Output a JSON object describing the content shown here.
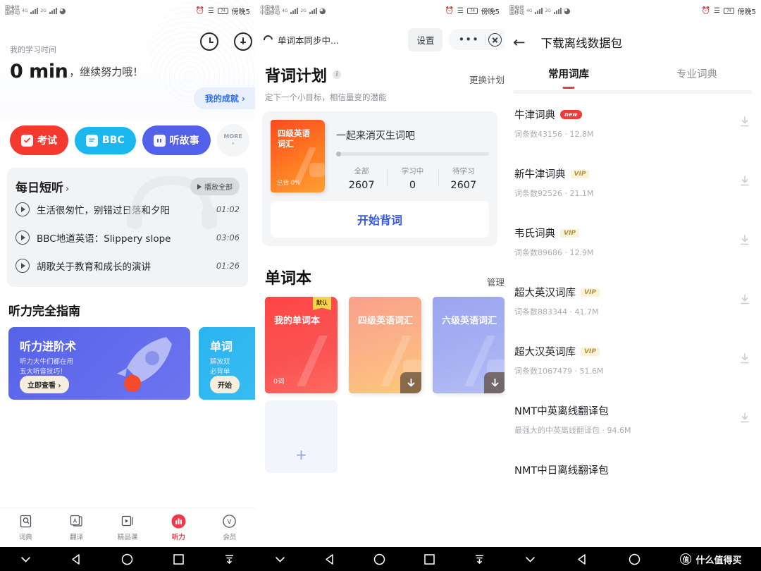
{
  "statusbar": {
    "carrier_line1": "国电信",
    "carrier_line2": "国移动",
    "carrier2_line1": "中国电信",
    "carrier2_line2": "中国移动",
    "net1": "4G",
    "net2": "2G",
    "battery": "74",
    "time": "傍晚5"
  },
  "screen1": {
    "study_label": "我的学习时间",
    "study_minutes": "0 min",
    "study_suffix": "，继续努力哦！",
    "achievement": "我的成就 ›",
    "quick": [
      {
        "label": "考试",
        "icon": "exam-icon",
        "color": "#f4392f"
      },
      {
        "label": "BBC",
        "icon": "bbc-icon",
        "color": "#1ab8ef"
      },
      {
        "label": "听故事",
        "icon": "story-icon",
        "color": "#5360ea"
      }
    ],
    "more_label": "MORE",
    "more_arrow": "›",
    "daily": {
      "title": "每日短听",
      "chevron": "›",
      "play_all": "播放全部",
      "items": [
        {
          "name": "生活很匆忙，别错过日落和夕阳",
          "time": "01:02"
        },
        {
          "name": "BBC地道英语：Slippery slope",
          "time": "03:06"
        },
        {
          "name": "胡歌关于教育和成长的演讲",
          "time": "01:26"
        }
      ]
    },
    "guide_title": "听力完全指南",
    "guide_cards": [
      {
        "title": "听力进阶术",
        "line1": "听力大牛们都在用",
        "line2": "五大听音技巧！",
        "button": "立即查看 ›"
      },
      {
        "title": "单词",
        "line1": "解放双",
        "line2": "必背单",
        "button": "开始"
      }
    ],
    "tabs": [
      {
        "label": "词典",
        "icon": "dictionary-icon",
        "active": false
      },
      {
        "label": "翻译",
        "icon": "translate-icon",
        "active": false
      },
      {
        "label": "精品课",
        "icon": "course-icon",
        "active": false
      },
      {
        "label": "听力",
        "icon": "listening-icon",
        "active": true
      },
      {
        "label": "会员",
        "icon": "vip-icon",
        "active": false
      }
    ]
  },
  "screen2": {
    "sync_text": "单词本同步中...",
    "settings_label": "设置",
    "more_dots": "•••",
    "plan_title": "背词计划",
    "plan_info": "i",
    "plan_change": "更换计划",
    "plan_subtitle": "定下一个小目标，相信量变的潜能",
    "plan_book": {
      "title": "四级英语\n词汇",
      "progress_label": "已背 0%"
    },
    "plan_slogan": "一起来消灭生词吧",
    "stats": [
      {
        "label": "全部",
        "value": "2607"
      },
      {
        "label": "学习中",
        "value": "0"
      },
      {
        "label": "待学习",
        "value": "2607"
      }
    ],
    "start_button": "开始背词",
    "wordbook_title": "单词本",
    "wordbook_manage": "管理",
    "wordbooks": [
      {
        "title": "我的单词本",
        "count": "0词",
        "badge": "默认"
      },
      {
        "title": "四级英语词汇",
        "count": "",
        "badge": ""
      },
      {
        "title": "六级英语词汇",
        "count": "",
        "badge": ""
      }
    ],
    "add_book": "+"
  },
  "screen3": {
    "back_icon": "back-arrow-icon",
    "title": "下载离线数据包",
    "tabs": [
      {
        "label": "常用词库",
        "active": true
      },
      {
        "label": "专业词典",
        "active": false
      }
    ],
    "dictionaries": [
      {
        "name": "牛津词典",
        "tag": "new",
        "tag_type": "new",
        "meta": "词条数43156 · 12.8M"
      },
      {
        "name": "新牛津词典",
        "tag": "VIP",
        "tag_type": "vip",
        "meta": "词条数92526 · 21.1M"
      },
      {
        "name": "韦氏词典",
        "tag": "VIP",
        "tag_type": "vip",
        "meta": "词条数89686 · 12.9M"
      },
      {
        "name": "超大英汉词库",
        "tag": "VIP",
        "tag_type": "vip",
        "meta": "词条数883344 · 41.7M"
      },
      {
        "name": "超大汉英词库",
        "tag": "VIP",
        "tag_type": "vip",
        "meta": "词条数1067479 · 51.6M"
      },
      {
        "name": "NMT中英离线翻译包",
        "tag": "",
        "tag_type": "",
        "meta": "最强大的中英离线翻译包 · 94.6M"
      },
      {
        "name": "NMT中日离线翻译包",
        "tag": "",
        "tag_type": "",
        "meta": ""
      }
    ]
  },
  "watermark": {
    "logo": "值",
    "text": "什么值得买"
  }
}
